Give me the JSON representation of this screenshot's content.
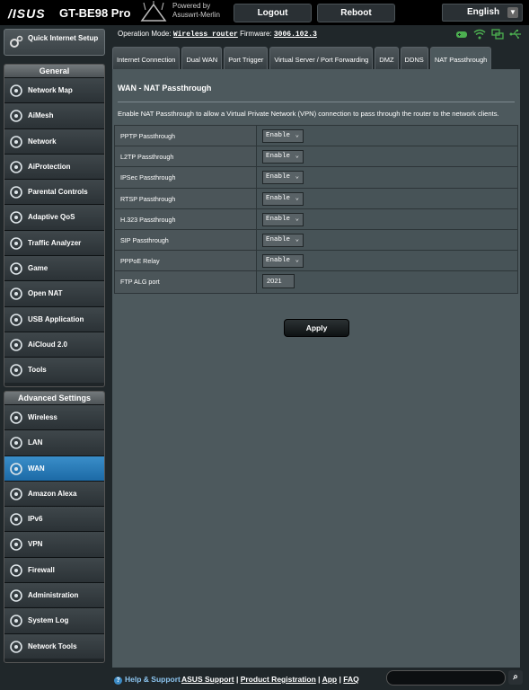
{
  "header": {
    "brand": "/ISUS",
    "model": "GT-BE98 Pro",
    "powered_by_1": "Powered by",
    "powered_by_2": "Asuswrt-Merlin",
    "logout": "Logout",
    "reboot": "Reboot",
    "language": "English"
  },
  "status": {
    "op_mode_label": "Operation Mode:",
    "op_mode_value": "Wireless router",
    "firmware_label": "Firmware:",
    "firmware_value": "3006.102.3"
  },
  "sidebar": {
    "qis": "Quick Internet Setup",
    "general_header": "General",
    "general": [
      {
        "label": "Network Map",
        "icon": "network-map-icon"
      },
      {
        "label": "AiMesh",
        "icon": "aimesh-icon"
      },
      {
        "label": "Network",
        "icon": "globe-icon"
      },
      {
        "label": "AiProtection",
        "icon": "shield-icon"
      },
      {
        "label": "Parental Controls",
        "icon": "family-icon"
      },
      {
        "label": "Adaptive QoS",
        "icon": "gauge-icon"
      },
      {
        "label": "Traffic Analyzer",
        "icon": "traffic-icon"
      },
      {
        "label": "Game",
        "icon": "gamepad-icon"
      },
      {
        "label": "Open NAT",
        "icon": "open-nat-icon"
      },
      {
        "label": "USB Application",
        "icon": "usb-icon"
      },
      {
        "label": "AiCloud 2.0",
        "icon": "cloud-icon"
      },
      {
        "label": "Tools",
        "icon": "wrench-icon"
      }
    ],
    "advanced_header": "Advanced Settings",
    "advanced": [
      {
        "label": "Wireless",
        "icon": "wifi-icon"
      },
      {
        "label": "LAN",
        "icon": "lan-icon"
      },
      {
        "label": "WAN",
        "icon": "wan-globe-icon"
      },
      {
        "label": "Amazon Alexa",
        "icon": "alexa-icon"
      },
      {
        "label": "IPv6",
        "icon": "ipv6-icon"
      },
      {
        "label": "VPN",
        "icon": "vpn-icon"
      },
      {
        "label": "Firewall",
        "icon": "firewall-icon"
      },
      {
        "label": "Administration",
        "icon": "admin-icon"
      },
      {
        "label": "System Log",
        "icon": "log-icon"
      },
      {
        "label": "Network Tools",
        "icon": "tools-icon"
      }
    ],
    "active_advanced_index": 2
  },
  "tabs": [
    {
      "label": "Internet Connection"
    },
    {
      "label": "Dual WAN"
    },
    {
      "label": "Port Trigger"
    },
    {
      "label": "Virtual Server / Port Forwarding"
    },
    {
      "label": "DMZ"
    },
    {
      "label": "DDNS"
    },
    {
      "label": "NAT Passthrough"
    }
  ],
  "active_tab": "NAT Passthrough",
  "page": {
    "title": "WAN - NAT Passthrough",
    "description": "Enable NAT Passthrough to allow a Virtual Private Network (VPN) connection to pass through the router to the network clients.",
    "rows": [
      {
        "label": "PPTP Passthrough",
        "value": "Enable"
      },
      {
        "label": "L2TP Passthrough",
        "value": "Enable"
      },
      {
        "label": "IPSec Passthrough",
        "value": "Enable"
      },
      {
        "label": "RTSP Passthrough",
        "value": "Enable"
      },
      {
        "label": "H.323 Passthrough",
        "value": "Enable"
      },
      {
        "label": "SIP Passthrough",
        "value": "Enable"
      },
      {
        "label": "PPPoE Relay",
        "value": "Enable"
      }
    ],
    "ftp_label": "FTP ALG port",
    "ftp_value": "2021",
    "apply": "Apply"
  },
  "footer": {
    "help": "Help & Support",
    "asus_support": "ASUS Support",
    "product_registration": "Product Registration",
    "app": "App",
    "faq": "FAQ",
    "sep": "|"
  },
  "colors": {
    "accent": "#1c6aa6",
    "status_green": "#4caf50",
    "help_blue": "#8cc5f0"
  }
}
